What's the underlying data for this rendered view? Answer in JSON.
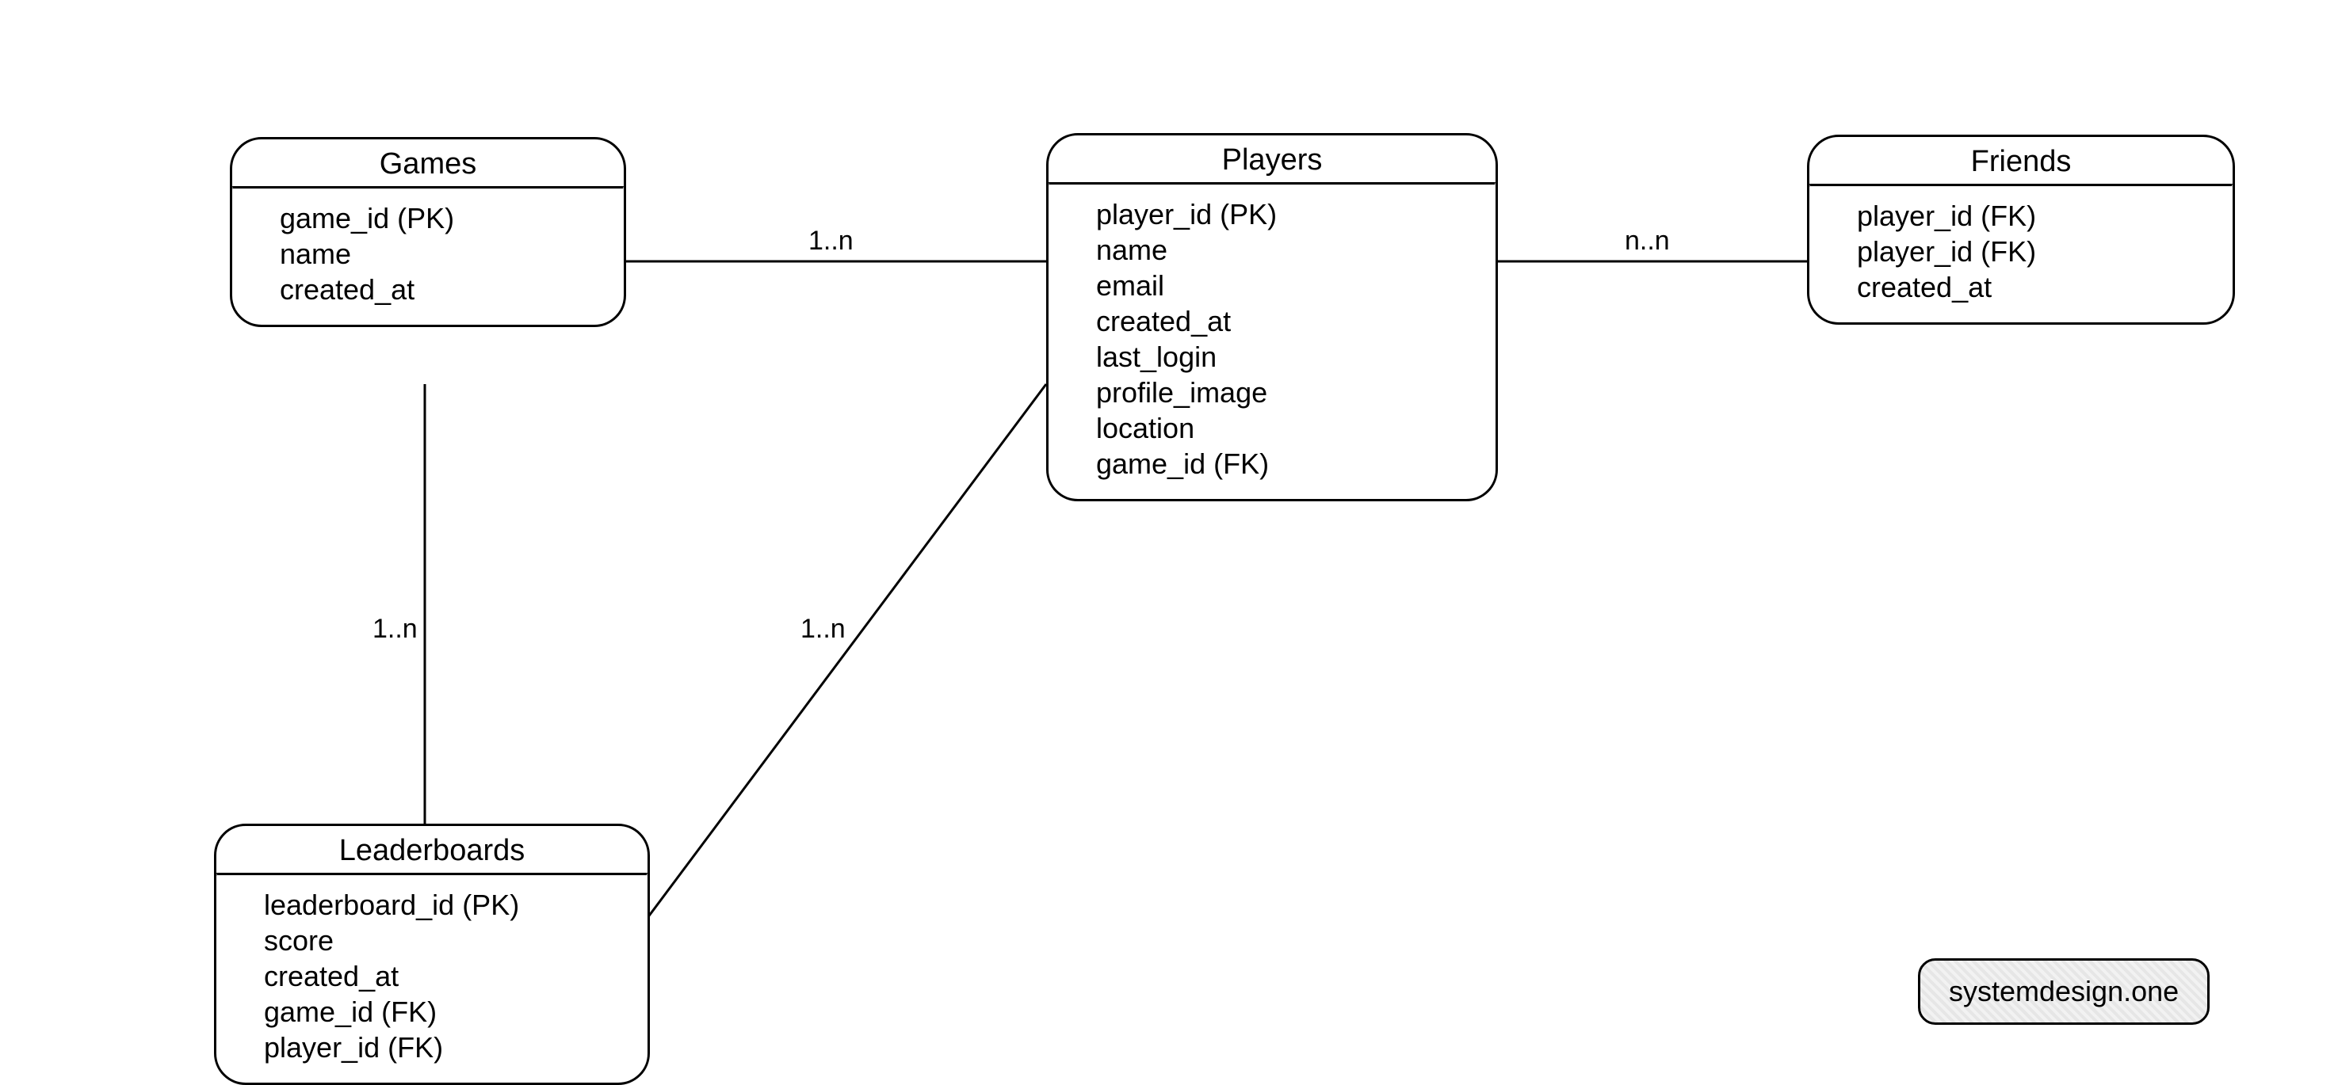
{
  "entities": {
    "games": {
      "title": "Games",
      "fields": [
        "game_id (PK)",
        "name",
        "created_at"
      ]
    },
    "players": {
      "title": "Players",
      "fields": [
        "player_id (PK)",
        "name",
        "email",
        "created_at",
        "last_login",
        "profile_image",
        "location",
        "game_id (FK)"
      ]
    },
    "friends": {
      "title": "Friends",
      "fields": [
        "player_id (FK)",
        "player_id (FK)",
        "created_at"
      ]
    },
    "leaderboards": {
      "title": "Leaderboards",
      "fields": [
        "leaderboard_id (PK)",
        "score",
        "created_at",
        "game_id (FK)",
        "player_id (FK)"
      ]
    }
  },
  "relations": {
    "games_players": "1..n",
    "games_leaderboards": "1..n",
    "players_leaderboards": "1..n",
    "players_friends": "n..n"
  },
  "watermark": "systemdesign.one"
}
